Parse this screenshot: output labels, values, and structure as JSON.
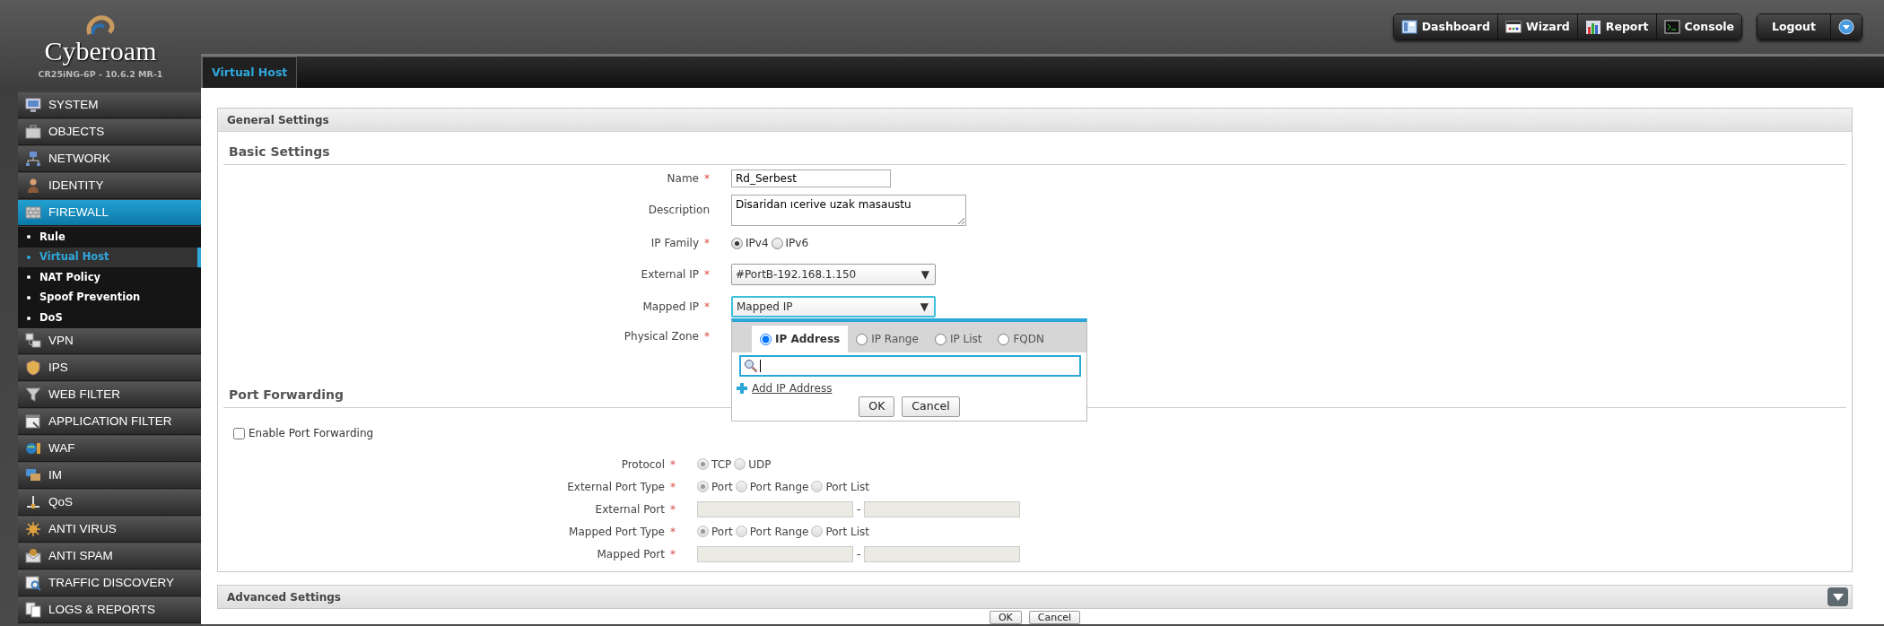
{
  "header": {
    "logo": "Cyberoam",
    "model": "CR25iNG-6P - 10.6.2 MR-1",
    "buttons": [
      {
        "label": "Dashboard",
        "kind": "dashboard"
      },
      {
        "label": "Wizard",
        "kind": "wizard"
      },
      {
        "label": "Report",
        "kind": "report"
      },
      {
        "label": "Console",
        "kind": "console"
      }
    ],
    "logout": "Logout"
  },
  "tabs": [
    {
      "label": "Virtual Host",
      "selected": true
    }
  ],
  "sidebar": {
    "items": [
      {
        "label": "SYSTEM",
        "kind": "system",
        "selected": false
      },
      {
        "label": "OBJECTS",
        "kind": "objects",
        "selected": false
      },
      {
        "label": "NETWORK",
        "kind": "network",
        "selected": false
      },
      {
        "label": "IDENTITY",
        "kind": "identity",
        "selected": false
      },
      {
        "label": "FIREWALL",
        "kind": "firewall",
        "selected": true,
        "children": [
          {
            "label": "Rule",
            "selected": false
          },
          {
            "label": "Virtual Host",
            "selected": true
          },
          {
            "label": "NAT Policy",
            "selected": false
          },
          {
            "label": "Spoof Prevention",
            "selected": false
          },
          {
            "label": "DoS",
            "selected": false
          }
        ]
      },
      {
        "label": "VPN",
        "kind": "vpn",
        "selected": false
      },
      {
        "label": "IPS",
        "kind": "ips",
        "selected": false
      },
      {
        "label": "WEB FILTER",
        "kind": "webfilter",
        "selected": false
      },
      {
        "label": "APPLICATION FILTER",
        "kind": "appfilter",
        "selected": false
      },
      {
        "label": "WAF",
        "kind": "waf",
        "selected": false
      },
      {
        "label": "IM",
        "kind": "im",
        "selected": false
      },
      {
        "label": "QoS",
        "kind": "qos",
        "selected": false
      },
      {
        "label": "ANTI VIRUS",
        "kind": "antivirus",
        "selected": false
      },
      {
        "label": "ANTI SPAM",
        "kind": "antispam",
        "selected": false
      },
      {
        "label": "TRAFFIC DISCOVERY",
        "kind": "traffic",
        "selected": false
      },
      {
        "label": "LOGS & REPORTS",
        "kind": "logs",
        "selected": false
      }
    ]
  },
  "general_settings": {
    "title": "General Settings",
    "basic_settings": {
      "title": "Basic Settings",
      "fields": [
        {
          "kind": "text",
          "label": "Name",
          "required_mark": "*",
          "value": "Rd_Serbest"
        },
        {
          "kind": "textarea",
          "label": "Description",
          "value": "Disaridan ıcerive uzak masaustu"
        },
        {
          "kind": "radio",
          "label": "IP Family",
          "required_mark": "*",
          "options": [
            {
              "label": "IPv4",
              "selected": true
            },
            {
              "label": "IPv6",
              "selected": false
            }
          ]
        },
        {
          "kind": "select",
          "label": "External IP",
          "required_mark": "*",
          "value": "#PortB-192.168.1.150",
          "arrow": "▼",
          "focused": false
        },
        {
          "kind": "select",
          "label": "Mapped IP",
          "required_mark": "*",
          "value": "Mapped IP",
          "arrow": "▼",
          "focused": true,
          "popup": {
            "tabs": [
              {
                "label": "IP Address",
                "selected": true
              },
              {
                "label": "IP Range",
                "selected": false
              },
              {
                "label": "IP List",
                "selected": false
              },
              {
                "label": "FQDN",
                "selected": false
              }
            ],
            "add_link": "Add IP Address",
            "buttons": [
              "OK",
              "Cancel"
            ]
          }
        },
        {
          "kind": "empty",
          "label": "Physical Zone",
          "required_mark": "*"
        }
      ]
    },
    "port_forwarding": {
      "title": "Port Forwarding",
      "enable": {
        "label": "Enable Port Forwarding",
        "checked": false
      },
      "fields": [
        {
          "kind": "radio",
          "label": "Protocol",
          "required_mark": "*",
          "disabled": true,
          "options": [
            {
              "label": "TCP",
              "selected": true
            },
            {
              "label": "UDP",
              "selected": false
            }
          ]
        },
        {
          "kind": "radio",
          "label": "External Port Type",
          "required_mark": "*",
          "disabled": true,
          "options": [
            {
              "label": "Port",
              "selected": true
            },
            {
              "label": "Port Range",
              "selected": false
            },
            {
              "label": "Port List",
              "selected": false
            }
          ]
        },
        {
          "kind": "range",
          "label": "External Port",
          "required_mark": "*",
          "disabled": true,
          "separator": "-"
        },
        {
          "kind": "radio",
          "label": "Mapped Port Type",
          "required_mark": "*",
          "disabled": true,
          "options": [
            {
              "label": "Port",
              "selected": true
            },
            {
              "label": "Port Range",
              "selected": false
            },
            {
              "label": "Port List",
              "selected": false
            }
          ]
        },
        {
          "kind": "range",
          "label": "Mapped Port",
          "required_mark": "*",
          "disabled": true,
          "separator": "-"
        }
      ]
    }
  },
  "advanced_settings": {
    "title": "Advanced Settings",
    "expanded": false
  },
  "footer_buttons": [
    "OK",
    "Cancel"
  ]
}
